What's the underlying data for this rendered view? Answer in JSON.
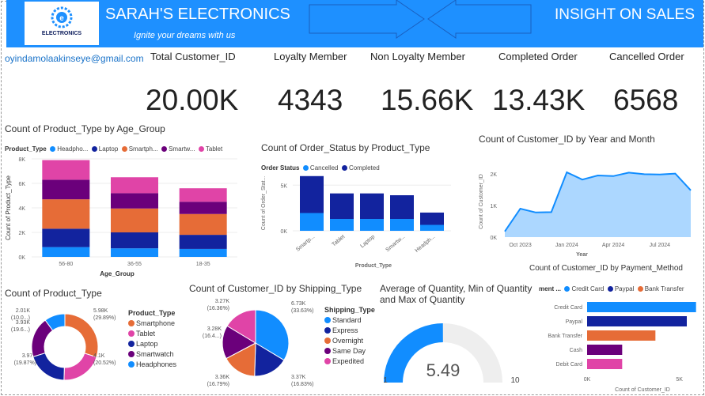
{
  "header": {
    "brand": "SARAH'S ELECTRONICS",
    "tagline": "Ignite your dreams with us",
    "logo_text": "ELECTRONICS",
    "title": "INSIGHT ON SALES",
    "color": "#1e90ff"
  },
  "email": "oyindamolaakinseye@gmail.com",
  "kpis": [
    {
      "label": "Total Customer_ID",
      "value": "20.00K"
    },
    {
      "label": "Loyalty Member",
      "value": "4343"
    },
    {
      "label": "Non Loyalty Member",
      "value": "15.66K"
    },
    {
      "label": "Completed Order",
      "value": "13.43K"
    },
    {
      "label": "Cancelled Order",
      "value": "6568"
    }
  ],
  "colors": {
    "Headphones": "#118dff",
    "Laptop": "#12239e",
    "Smartphone": "#e66c37",
    "Smartwatch": "#6b007b",
    "Tablet": "#e044a7",
    "Cancelled": "#118dff",
    "Completed": "#12239e",
    "gauge": "#118dff",
    "gauge_bg": "#eeeeee"
  },
  "chart_data": [
    {
      "type": "bar",
      "title": "Count of Product_Type by Age_Group",
      "legend_title": "Product_Type",
      "legend": [
        "Headpho...",
        "Laptop",
        "Smartph...",
        "Smartw...",
        "Tablet"
      ],
      "xlabel": "Age_Group",
      "ylabel": "Count of Product_Type",
      "categories": [
        "56-80",
        "36-55",
        "18-35"
      ],
      "ylim": [
        0,
        8000
      ],
      "yticks": [
        "0K",
        "2K",
        "4K",
        "6K",
        "8K"
      ],
      "series": [
        {
          "name": "Headphones",
          "values": [
            800,
            700,
            650
          ]
        },
        {
          "name": "Laptop",
          "values": [
            1500,
            1300,
            1150
          ]
        },
        {
          "name": "Smartphone",
          "values": [
            2400,
            1950,
            1700
          ]
        },
        {
          "name": "Smartwatch",
          "values": [
            1600,
            1250,
            1000
          ]
        },
        {
          "name": "Tablet",
          "values": [
            1600,
            1300,
            1100
          ]
        }
      ]
    },
    {
      "type": "bar",
      "title": "Count of Order_Status by Product_Type",
      "legend_title": "Order Status",
      "legend": [
        "Cancelled",
        "Completed"
      ],
      "xlabel": "Product_Type",
      "ylabel": "Count of Order_Stat...",
      "categories": [
        "Smartp...",
        "Tablet",
        "Laptop",
        "Smartw...",
        "Headph..."
      ],
      "ylim": [
        0,
        6500
      ],
      "yticks": [
        "0K",
        "5K"
      ],
      "series": [
        {
          "name": "Cancelled",
          "values": [
            1950,
            1300,
            1300,
            1300,
            650
          ]
        },
        {
          "name": "Completed",
          "values": [
            4050,
            2800,
            2800,
            2600,
            1350
          ]
        }
      ]
    },
    {
      "type": "area",
      "title": "Count of Customer_ID by Year and Month",
      "xlabel": "Year",
      "ylabel": "Count of Customer_ID",
      "x": [
        "Sep 2023",
        "Oct 2023",
        "Nov 2023",
        "Dec 2023",
        "Jan 2024",
        "Feb 2024",
        "Mar 2024",
        "Apr 2024",
        "May 2024",
        "Jun 2024",
        "Jul 2024",
        "Aug 2024",
        "Sep 2024"
      ],
      "xticks": [
        "Oct 2023",
        "Jan 2024",
        "Apr 2024",
        "Jul 2024"
      ],
      "values": [
        180,
        900,
        780,
        790,
        2050,
        1820,
        1950,
        1930,
        2040,
        1990,
        1980,
        2010,
        1480
      ],
      "ylim": [
        0,
        2200
      ],
      "yticks": [
        "0K",
        "1K",
        "2K"
      ]
    },
    {
      "type": "pie",
      "title": "Count of Product_Type",
      "donut": true,
      "legend_title": "Product_Type",
      "slices": [
        {
          "name": "Smartphone",
          "value": 5980,
          "label": "5.98K",
          "pct": "(29.89%)"
        },
        {
          "name": "Tablet",
          "value": 4100,
          "label": "4.1K",
          "pct": "(20.52%)"
        },
        {
          "name": "Laptop",
          "value": 3970,
          "label": "3.97K",
          "pct": "(19.87%)"
        },
        {
          "name": "Smartwatch",
          "value": 3930,
          "label": "3.93K",
          "pct": "(19.6...)"
        },
        {
          "name": "Headphones",
          "value": 2010,
          "label": "2.01K",
          "pct": "(10.0...)"
        }
      ]
    },
    {
      "type": "pie",
      "title": "Count of Customer_ID by Shipping_Type",
      "legend_title": "Shipping_Type",
      "slices": [
        {
          "name": "Standard",
          "value": 6730,
          "label": "6.73K",
          "pct": "(33.63%)"
        },
        {
          "name": "Express",
          "value": 3370,
          "label": "3.37K",
          "pct": "(16.83%)"
        },
        {
          "name": "Overnight",
          "value": 3360,
          "label": "3.36K",
          "pct": "(16.79%)"
        },
        {
          "name": "Same Day",
          "value": 3280,
          "label": "3.28K",
          "pct": "(16.4...)"
        },
        {
          "name": "Expedited",
          "value": 3270,
          "label": "3.27K",
          "pct": "(16.36%)"
        }
      ],
      "colors": [
        "#118dff",
        "#12239e",
        "#e66c37",
        "#6b007b",
        "#e044a7"
      ]
    },
    {
      "type": "gauge",
      "title": "Average of Quantity, Min of Quantity and Max of Quantity",
      "value": 5.49,
      "value_label": "5.49",
      "min": 1,
      "max": 10,
      "min_label": "1",
      "max_label": "10"
    },
    {
      "type": "bar",
      "orientation": "horizontal",
      "title": "Count of Customer_ID by Payment_Method",
      "legend_title": "ment ...",
      "legend": [
        "Credit Card",
        "Paypal",
        "Bank Transfer"
      ],
      "categories": [
        "Credit Card",
        "Paypal",
        "Bank Transfer",
        "Cash",
        "Debit Card"
      ],
      "values": [
        5900,
        5400,
        3700,
        1900,
        1900
      ],
      "colors": [
        "#118dff",
        "#12239e",
        "#e66c37",
        "#6b007b",
        "#e044a7"
      ],
      "xlim": [
        0,
        6000
      ],
      "xticks": [
        "0K",
        "5K"
      ],
      "xlabel": "Count of Customer_ID"
    }
  ]
}
